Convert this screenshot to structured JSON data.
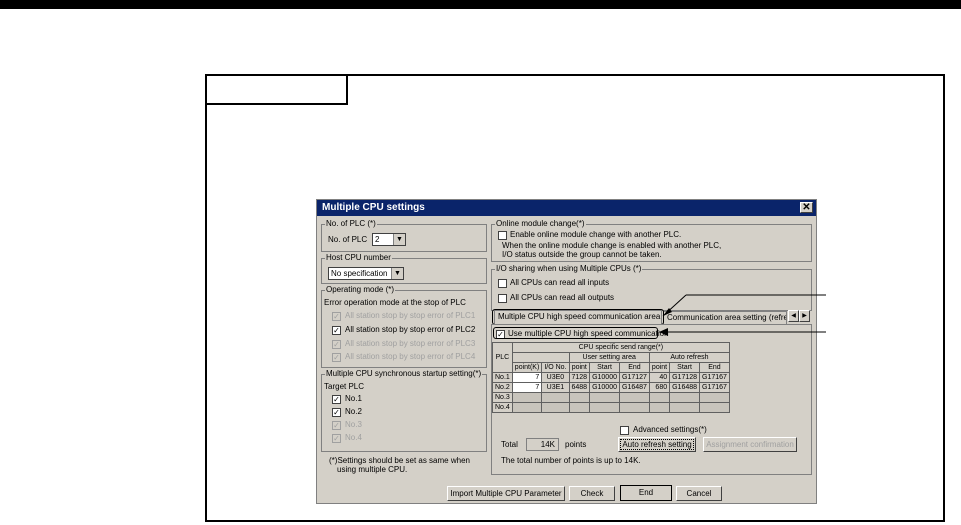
{
  "dialog": {
    "title": "Multiple CPU settings",
    "close_glyph": "✕",
    "no_of_plc": {
      "group_title": "No. of PLC (*)",
      "label": "No. of PLC",
      "value": "2"
    },
    "host_cpu": {
      "group_title": "Host CPU number",
      "value": "No specification"
    },
    "operating_mode": {
      "group_title": "Operating mode (*)",
      "subtitle": "Error operation mode at the stop of PLC",
      "items": [
        {
          "label": "All station stop by stop error of PLC1",
          "checked": true,
          "enabled": false
        },
        {
          "label": "All station stop by stop error of PLC2",
          "checked": true,
          "enabled": true
        },
        {
          "label": "All station stop by stop error of PLC3",
          "checked": true,
          "enabled": false
        },
        {
          "label": "All station stop by stop error of PLC4",
          "checked": true,
          "enabled": false
        }
      ]
    },
    "sync_startup": {
      "group_title": "Multiple CPU synchronous startup setting(*)",
      "target_label": "Target PLC",
      "items": [
        {
          "label": "No.1",
          "checked": true,
          "enabled": true
        },
        {
          "label": "No.2",
          "checked": true,
          "enabled": true
        },
        {
          "label": "No.3",
          "checked": true,
          "enabled": false
        },
        {
          "label": "No.4",
          "checked": true,
          "enabled": false
        }
      ]
    },
    "note": [
      "(*)Settings should be set as same when",
      "using multiple CPU."
    ],
    "online_module": {
      "group_title": "Online module change(*)",
      "checkbox_label": "Enable online module change with another PLC.",
      "checked": false,
      "desc1": "When the online module change is enabled with another PLC,",
      "desc2": "I/O status outside the group cannot be taken."
    },
    "io_sharing": {
      "group_title": "I/O sharing when using Multiple CPUs (*)",
      "items": [
        {
          "label": "All CPUs can read all inputs",
          "checked": false
        },
        {
          "label": "All CPUs can read all outputs",
          "checked": false
        }
      ]
    },
    "tabs": [
      {
        "label": "Multiple CPU high speed communication area setting"
      },
      {
        "label": "Communication area setting (refresh setting)"
      }
    ],
    "tab_scroll": {
      "left": "◀",
      "right": "▶"
    },
    "use_high_speed": {
      "label": "Use multiple CPU high speed communication",
      "checked": true
    },
    "table": {
      "plc_header": "PLC",
      "group_header": "CPU specific send range(*)",
      "user_area_header": "User setting area",
      "auto_refresh_header": "Auto refresh",
      "columns": [
        "point(K)",
        "I/O No.",
        "point",
        "Start",
        "End",
        "point",
        "Start",
        "End"
      ],
      "rows": [
        {
          "plc": "No.1",
          "cells": [
            "7",
            "U3E0",
            "7128",
            "G10000",
            "G17127",
            "40",
            "G17128",
            "G17167"
          ]
        },
        {
          "plc": "No.2",
          "cells": [
            "7",
            "U3E1",
            "6488",
            "G10000",
            "G16487",
            "680",
            "G16488",
            "G17167"
          ]
        },
        {
          "plc": "No.3",
          "cells": [
            "",
            "",
            "",
            "",
            "",
            "",
            "",
            ""
          ]
        },
        {
          "plc": "No.4",
          "cells": [
            "",
            "",
            "",
            "",
            "",
            "",
            "",
            ""
          ]
        }
      ]
    },
    "advanced": {
      "label": "Advanced settings(*)",
      "checked": false
    },
    "total": {
      "label": "Total",
      "value": "14K",
      "unit": "points"
    },
    "total_note": "The total number of points is up to 14K.",
    "buttons": {
      "auto_refresh": "Auto refresh setting",
      "assignment": "Assignment confirmation",
      "import": "Import Multiple CPU Parameter",
      "check": "Check",
      "end": "End",
      "cancel": "Cancel"
    },
    "check_glyph": "✓"
  }
}
